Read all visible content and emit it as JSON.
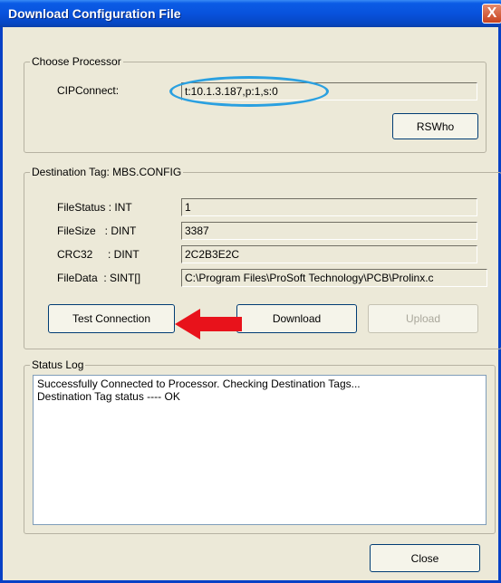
{
  "window": {
    "title": "Download Configuration File",
    "close_label": "X"
  },
  "processor": {
    "legend": "Choose Processor",
    "cip_label": "CIPConnect:",
    "cip_value": "t:10.1.3.187,p:1,s:0",
    "rswho_label": "RSWho"
  },
  "destination": {
    "legend": "Destination Tag: MBS.CONFIG",
    "rows": [
      {
        "label": "FileStatus : INT",
        "value": "1"
      },
      {
        "label": "FileSize   : DINT",
        "value": "3387"
      },
      {
        "label": "CRC32     : DINT",
        "value": "2C2B3E2C"
      },
      {
        "label": "FileData  : SINT[]",
        "value": "C:\\Program Files\\ProSoft Technology\\PCB\\Prolinx.c"
      }
    ],
    "test_label": "Test Connection",
    "download_label": "Download",
    "upload_label": "Upload"
  },
  "status": {
    "legend": "Status Log",
    "lines": [
      "Successfully Connected to Processor. Checking Destination Tags...",
      "Destination Tag status ---- OK"
    ]
  },
  "footer": {
    "close_label": "Close"
  },
  "colors": {
    "highlight_ellipse": "#2aa0e0",
    "annotation_arrow": "#e8121b"
  }
}
